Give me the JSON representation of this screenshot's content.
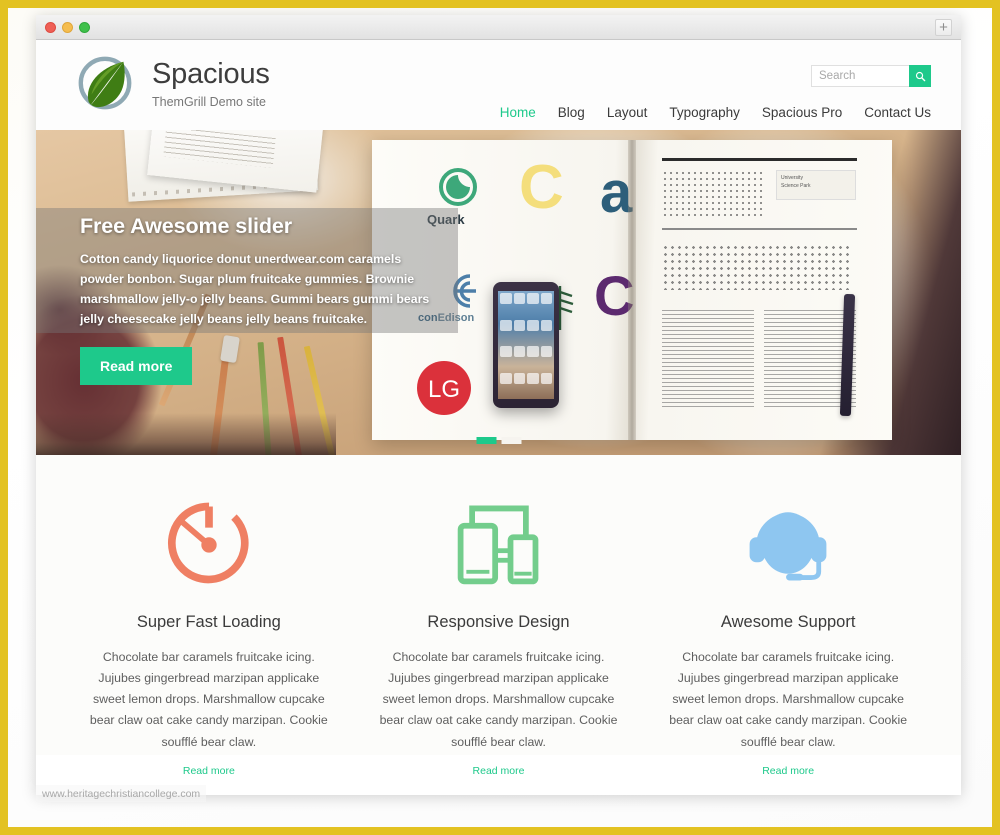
{
  "browser": {
    "window_controls": [
      "close",
      "minimize",
      "maximize"
    ],
    "new_tab_label": "+",
    "status_url": "www.heritagechristiancollege.com"
  },
  "header": {
    "logo_icon": "leaf-in-circle-logo",
    "site_title": "Spacious",
    "tagline": "ThemGrill Demo site"
  },
  "search": {
    "placeholder": "Search",
    "value": "",
    "submit_icon": "search-icon",
    "submit_color": "#1ec98b"
  },
  "nav": {
    "items": [
      {
        "label": "Home",
        "active": true
      },
      {
        "label": "Blog",
        "active": false
      },
      {
        "label": "Layout",
        "active": false
      },
      {
        "label": "Typography",
        "active": false
      },
      {
        "label": "Spacious Pro",
        "active": false
      },
      {
        "label": "Contact Us",
        "active": false
      }
    ],
    "active_color": "#1ec98b"
  },
  "slider": {
    "title": "Free Awesome slider",
    "description": "Cotton candy liquorice donut unerdwear.com caramels powder bonbon. Sugar plum fruitcake gummies. Brownie marshmallow jelly-o jelly beans. Gummi bears gummi bears jelly cheesecake jelly beans jelly beans fruitcake.",
    "button_label": "Read more",
    "button_color": "#1ec98b",
    "pagination": [
      {
        "index": 1,
        "active": true
      },
      {
        "index": 2,
        "active": false
      }
    ],
    "image_logos": [
      "Quark",
      "con Edison",
      "LG"
    ]
  },
  "features": [
    {
      "icon": "speedometer-icon",
      "icon_color": "#ef7f63",
      "title": "Super Fast Loading",
      "text": "Chocolate bar caramels fruitcake icing. Jujubes gingerbread marzipan applicake sweet lemon drops. Marshmallow cupcake bear claw oat cake candy marzipan. Cookie soufflé bear claw.",
      "link_label": "Read more"
    },
    {
      "icon": "responsive-devices-icon",
      "icon_color": "#73cd8c",
      "title": "Responsive Design",
      "text": "Chocolate bar caramels fruitcake icing. Jujubes gingerbread marzipan applicake sweet lemon drops. Marshmallow cupcake bear claw oat cake candy marzipan. Cookie soufflé bear claw.",
      "link_label": "Read more"
    },
    {
      "icon": "headset-support-icon",
      "icon_color": "#8ec6f0",
      "title": "Awesome Support",
      "text": "Chocolate bar caramels fruitcake icing. Jujubes gingerbread marzipan applicake sweet lemon drops. Marshmallow cupcake bear claw oat cake candy marzipan. Cookie soufflé bear claw.",
      "link_label": "Read more"
    }
  ],
  "theme": {
    "frame_color": "#e3c222",
    "accent_green": "#1ec98b"
  }
}
